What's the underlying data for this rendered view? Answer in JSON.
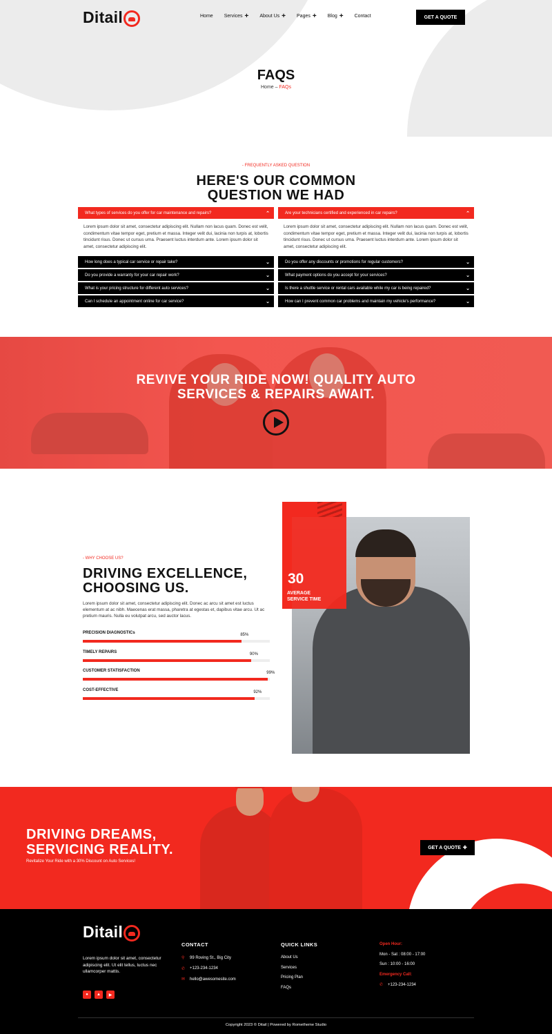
{
  "header": {
    "logo_text": "Ditail",
    "nav": [
      {
        "label": "Home",
        "has_plus": false
      },
      {
        "label": "Services",
        "has_plus": true
      },
      {
        "label": "About Us",
        "has_plus": true
      },
      {
        "label": "Pages",
        "has_plus": true
      },
      {
        "label": "Blog",
        "has_plus": true
      },
      {
        "label": "Contact",
        "has_plus": false
      }
    ],
    "quote_button": "GET A QUOTE"
  },
  "hero": {
    "title": "FAQS",
    "breadcrumb_home": "Home",
    "breadcrumb_sep": " – ",
    "breadcrumb_current": "FAQs"
  },
  "faq": {
    "eyebrow": "- FREQUENTLY ASKED QUESTION",
    "title_line1": "HERE'S OUR COMMON",
    "title_line2": "QUESTION WE HAD",
    "left": {
      "open_question": "What types of services do you offer for car maintenance and repairs?",
      "answer": "Lorem ipsum dolor sit amet, consectetur adipiscing elit. Nullam non lacus quam. Donec est velit, condimentum vitae tempor eget, pretium et massa. Integer velit dui, lacinia non turpis at, lobortis tincidunt risus. Donec ut cursus urna. Praesent luctus interdum ante. Lorem ipsum dolor sit amet, consectetur adipiscing elit.",
      "questions": [
        "How long does a typical car service or repair take?",
        "Do you provide a warranty for your car repair work?",
        "What is your pricing structure for different auto services?",
        "Can I schedule an appointment online for car service?"
      ]
    },
    "right": {
      "open_question": "Are your technicians certified and experienced in car repairs?",
      "answer": "Lorem ipsum dolor sit amet, consectetur adipiscing elit. Nullam non lacus quam. Donec est velit, condimentum vitae tempor eget, pretium et massa. Integer velit dui, lacinia non turpis at, lobortis tincidunt risus. Donec ut cursus urna. Praesent luctus interdum ante. Lorem ipsum dolor sit amet, consectetur adipiscing elit.",
      "questions": [
        "Do you offer any discounts or promotions for regular customers?",
        "What payment options do you accept for your services?",
        "Is there a shuttle service or rental cars available while my car is being repaired?",
        "How can I prevent common car problems and maintain my vehicle's performance?"
      ]
    }
  },
  "banner": {
    "title_line1": "REVIVE YOUR RIDE NOW! QUALITY AUTO",
    "title_line2": "SERVICES & REPAIRS AWAIT.",
    "play_icon": "play-icon"
  },
  "why": {
    "eyebrow": "- WHY CHOOSE US?",
    "title_line1": "DRIVING EXCELLENCE,",
    "title_line2": "CHOOSING US.",
    "description": "Lorem ipsum dolor sit amet, consectetur adipiscing elit. Donec ac arcu sit amet est luctus elementum at ac nibh. Maecenas erat massa, pharetra at egestas et, dapibus vitae arcu. Ut ac pretium mauris. Nulla eu volutpat arcu, sed auctor lacus.",
    "skills": [
      {
        "label": "PRECISION DIAGNOSTICs",
        "pct_text": "85%",
        "value": 0.85
      },
      {
        "label": "TIMELY REPAIRS",
        "pct_text": "90%",
        "value": 0.9
      },
      {
        "label": "CUSTOMER STATISFACTION",
        "pct_text": "99%",
        "value": 0.99
      },
      {
        "label": "COST-EFFECTIVE",
        "pct_text": "92%",
        "value": 0.92
      }
    ],
    "stat_number": "30",
    "stat_label_line1": "AVERAGE",
    "stat_label_line2": "SERVICE TIME"
  },
  "cta": {
    "title_line1": "DRIVING DREAMS,",
    "title_line2": "SERVICING REALITY.",
    "subtitle": "Revitalize Your Ride with a 30% Discount on Auto Services!",
    "button": "GET A QUOTE"
  },
  "footer": {
    "logo_text": "Ditail",
    "description": "Lorem ipsum dolor sit amet, consectetur adipiscing elit. Ut elit tellus, luctus nec ullamcorper mattis.",
    "social": [
      "dribbble-icon",
      "twitter-icon",
      "youtube-icon"
    ],
    "contact_title": "CONTACT",
    "contact": [
      "99 Roving St., Big City",
      "+123-234-1234",
      "hello@awesomesite.com"
    ],
    "links_title": "QUICK LINKS",
    "links": [
      "About Us",
      "Services",
      "Pricing Plan",
      "FAQs"
    ],
    "open_hour_label": "Open Hour:",
    "hours": [
      "Mon - Sat : 08:00 - 17:00",
      "Sun : 10:00 - 16:00"
    ],
    "emergency_label": "Emergency Call:",
    "emergency_phone": "+123-234-1234",
    "copyright": "Copyright 2023 © Ditail | Powered by Rometheme Studio"
  },
  "colors": {
    "accent": "#f2291f",
    "dark": "#000000",
    "light_gray": "#ececec"
  }
}
